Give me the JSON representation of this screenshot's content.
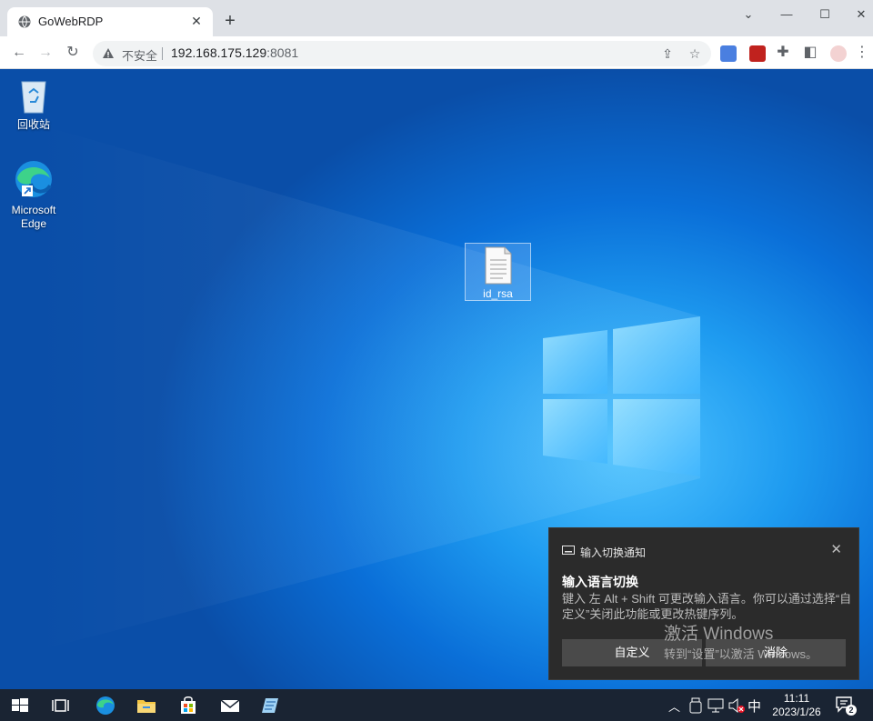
{
  "browser": {
    "tab_title": "GoWebRDP",
    "new_tab": "+",
    "security_label": "不安全",
    "url_host": "192.168.175.129",
    "url_port": ":8081"
  },
  "desktop": {
    "icons": [
      {
        "label": "回收站"
      },
      {
        "label": "Microsoft Edge"
      }
    ],
    "file": {
      "label": "id_rsa"
    }
  },
  "notification": {
    "header": "输入切换通知",
    "title": "输入语言切换",
    "body": "键入 左 Alt + Shift 可更改输入语言。你可以通过选择“自定义”关闭此功能或更改热键序列。",
    "button_customize": "自定义",
    "button_dismiss": "消除"
  },
  "watermark": {
    "line1": "激活 Windows",
    "line2": "转到“设置”以激活 Windows。"
  },
  "taskbar": {
    "ime": "中",
    "time": "11:11",
    "date": "2023/1/26",
    "notification_count": "2"
  },
  "colors": {
    "desktop_blue": "#0a6fd8",
    "taskbar": "#1a2433",
    "toast_bg": "#2b2b2b"
  }
}
